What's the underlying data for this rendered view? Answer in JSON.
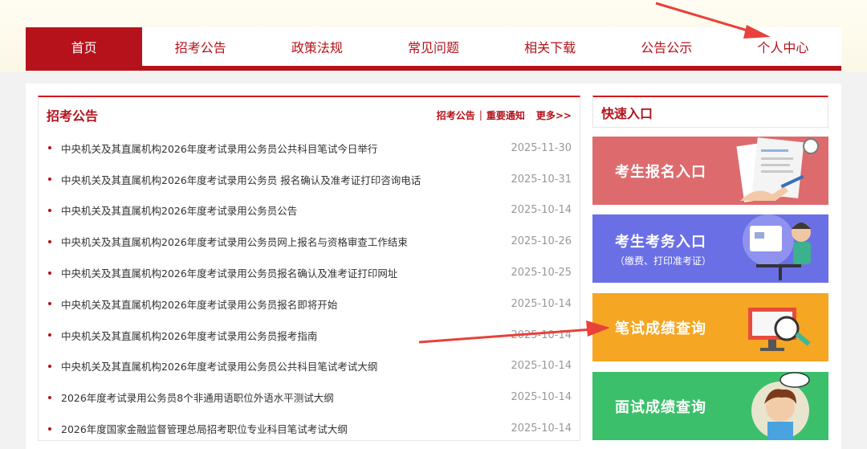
{
  "nav": {
    "items": [
      {
        "label": "首页",
        "active": true
      },
      {
        "label": "招考公告",
        "active": false
      },
      {
        "label": "政策法规",
        "active": false
      },
      {
        "label": "常见问题",
        "active": false
      },
      {
        "label": "相关下载",
        "active": false
      },
      {
        "label": "公告公示",
        "active": false
      },
      {
        "label": "个人中心",
        "active": false
      }
    ]
  },
  "notice": {
    "title": "招考公告",
    "link_1": "招考公告",
    "separator": "|",
    "link_2": "重要通知",
    "more": "更多>>",
    "items": [
      {
        "text": "中央机关及其直属机构2026年度考试录用公务员公共科目笔试今日举行",
        "date": "2025-11-30"
      },
      {
        "text": "中央机关及其直属机构2026年度考试录用公务员 报名确认及准考证打印咨询电话",
        "date": "2025-10-31"
      },
      {
        "text": "中央机关及其直属机构2026年度考试录用公务员公告",
        "date": "2025-10-14"
      },
      {
        "text": "中央机关及其直属机构2026年度考试录用公务员网上报名与资格审查工作结束",
        "date": "2025-10-26"
      },
      {
        "text": "中央机关及其直属机构2026年度考试录用公务员报名确认及准考证打印网址",
        "date": "2025-10-25"
      },
      {
        "text": "中央机关及其直属机构2026年度考试录用公务员报名即将开始",
        "date": "2025-10-14"
      },
      {
        "text": "中央机关及其直属机构2026年度考试录用公务员报考指南",
        "date": "2025-10-14"
      },
      {
        "text": "中央机关及其直属机构2026年度考试录用公务员公共科目笔试考试大纲",
        "date": "2025-10-14"
      },
      {
        "text": "2026年度考试录用公务员8个非通用语职位外语水平测试大纲",
        "date": "2025-10-14"
      },
      {
        "text": "2026年度国家金融监督管理总局招考职位专业科目笔试考试大纲",
        "date": "2025-10-14"
      }
    ]
  },
  "quick": {
    "title": "快速入口",
    "tiles": [
      {
        "main": "考生报名入口",
        "sub": "",
        "color": "#dd6b6e"
      },
      {
        "main": "考生考务入口",
        "sub": "（缴费、打印准考证）",
        "color": "#6a6fe6"
      },
      {
        "main": "笔试成绩查询",
        "sub": "",
        "color": "#f5a623"
      },
      {
        "main": "面试成绩查询",
        "sub": "",
        "color": "#3cbf6b"
      }
    ]
  },
  "colors": {
    "brand_red": "#b5121b",
    "annotation_arrow": "#e8413a"
  }
}
